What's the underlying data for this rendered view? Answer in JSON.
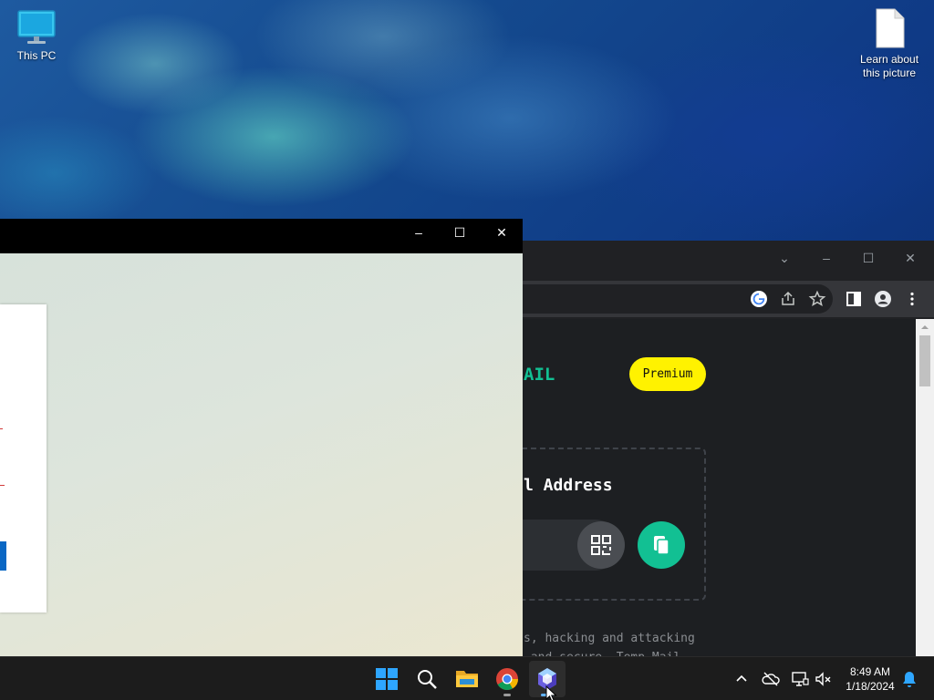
{
  "desktop": {
    "icons": [
      {
        "label": "This PC"
      },
      {
        "label": "Learn about this picture"
      }
    ]
  },
  "chrome": {
    "controls": {
      "collapse": "⌄",
      "minimize": "–",
      "maximize": "☐",
      "close": "✕"
    },
    "toolbar_icons": [
      "google-icon",
      "share-icon",
      "bookmark-star-icon",
      "side-panel-icon",
      "profile-icon",
      "menu-icon"
    ],
    "page": {
      "logo_fragment": "AIL",
      "premium_label": "Premium",
      "address_heading": "l Address",
      "description": "s, hacking and attacking\n and secure. Temp Mail"
    }
  },
  "app_window": {
    "controls": {
      "minimize": "–",
      "maximize": "☐",
      "close": "✕"
    }
  },
  "taskbar": {
    "apps": [
      "start",
      "search",
      "file-explorer",
      "chrome",
      "active-app"
    ],
    "clock": {
      "time": "8:49 AM",
      "date": "1/18/2024"
    }
  },
  "colors": {
    "accent_green": "#12c093",
    "premium_yellow": "#fff200",
    "taskbar_bg": "#1c1c1c"
  }
}
